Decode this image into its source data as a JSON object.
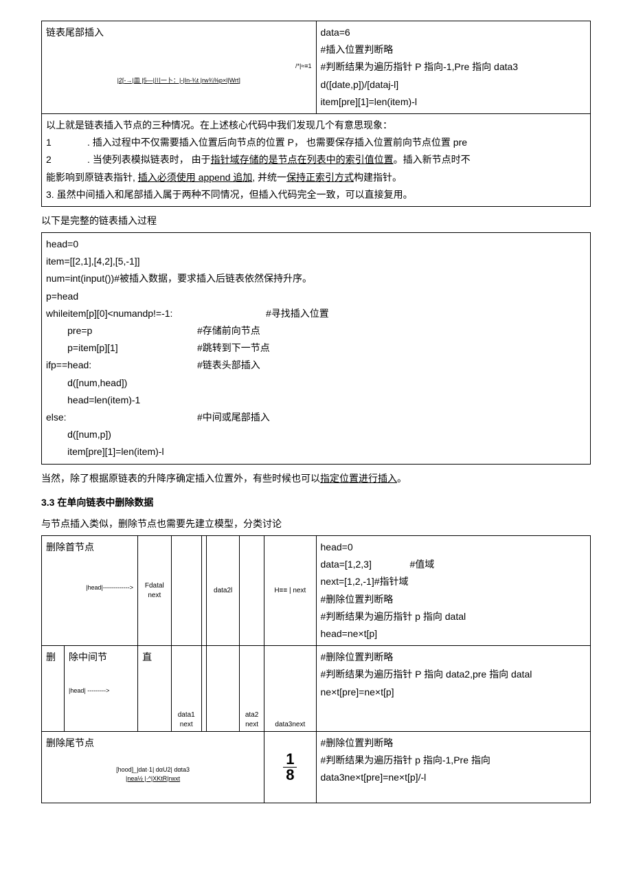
{
  "table1": {
    "left_title": "链表尾部插入",
    "left_diag1": "/*|≈≡1",
    "left_diag2": "|2[-→|皿 |5—|川一卜：|-|In-¾t    |rw¾%p×l|Wrt]",
    "right": {
      "l1": "data=6",
      "l2": "#插入位置判断略",
      "l3": "#判断结果为遍历指针 P 指向-1,Pre 指向 data3",
      "l4": "d([date,p])/[dataj-l]",
      "l5": "item[pre][1]=len(item)-l"
    },
    "summary": {
      "l1": "以上就是链表插入节点的三种情况。在上述核心代码中我们发现几个有意思现象：",
      "l2a": "1",
      "l2b": ". 插入过程中不仅需要插入位置后向节点的位置 P， 也需要保存插入位置前向节点位置 pre",
      "l3a": "2",
      "l3b_pre": ". 当使列表模拟链表时， 由于",
      "l3b_u": "指针域存储的是节点在列表中的索引值位置",
      "l3b_post": "。插入新节点时不",
      "l4_pre": "能影响到原链表指针, ",
      "l4_u1": "插入必须使用 append 追加",
      "l4_mid": ", 并统一",
      "l4_u2": "保持正索引方式",
      "l4_post": "构建指针。",
      "l5": "3. 虽然中间插入和尾部插入属于两种不同情况，但插入代码完全一致，可以直接复用。"
    }
  },
  "pre_code": "以下是完整的链表插入过程",
  "code": {
    "l1": "head=0",
    "l2": "item=[[2,1],[4,2],[5,-1]]",
    "l3": "num=int(input())#被插入数据，要求插入后链表依然保持升序。",
    "l4": "p=head",
    "l5a": "whileitem[p][0]<numandp!=-1:",
    "l5b": "#寻找插入位置",
    "l6a": "        pre=p",
    "l6b": "#存储前向节点",
    "l7a": "        p=item[p][1]",
    "l7b": "#跳转到下一节点",
    "l8a": "ifp==head:",
    "l8b": "#链表头部插入",
    "l9": "        d([num,head])",
    "l10": "        head=len(item)-1",
    "l11a": "else:",
    "l11b": "#中间或尾部插入",
    "l12": "        d([num,p])",
    "l13": "        item[pre][1]=len(item)-l"
  },
  "post_code_pre": "当然，除了根据原链表的升降序确定插入位置外，有些时候也可以",
  "post_code_u": "指定位置进行插入",
  "post_code_post": "。",
  "section": "3.3   在单向链表中删除数据",
  "section_intro": "与节点插入类似，删除节点也需要先建立模型，分类讨论",
  "table2": {
    "r1": {
      "c1": "删除首节点",
      "c3": "Fdatal\nnext",
      "c6": "data2l",
      "c8": "H≡≡ | next",
      "left_diag": "|head|------------->",
      "rc": {
        "l1": "head=0",
        "l2a": "data=[1,2,3]",
        "l2b": "#值域",
        "l3": "next=[1,2,-1]#指针域",
        "l4": "#删除位置判断略",
        "l5": "#判断结果为遍历指针 p 指向 datal",
        "l6": "head=ne×t[p]"
      }
    },
    "r2": {
      "c1a": "删",
      "c1b": "除中间节",
      "c2": "直",
      "c3": "data1\nnext",
      "c6": "ata2\nnext",
      "c8": "data3next",
      "left_diag": "|head| --------->",
      "rc": {
        "l1": "#删除位置判断略",
        "l2": "#判断结果为遍历指针 P 指向 data2,pre 指向 datal",
        "l3": "ne×t[pre]=ne×t[p]"
      }
    },
    "r3": {
      "c1": "删除尾节点",
      "diag1": "[hood]_|dat·1|               dαU2|         dαta3",
      "diag2": "|nea½ |·^|XKtR|rwxt",
      "frac_top": "1",
      "frac_bot": "8",
      "rc": {
        "l1": "#删除位置判断略",
        "l2": "#判断结果为遍历指针 p 指向-1,Pre 指向",
        "l3": "data3ne×t[pre]=ne×t[p]/-l"
      }
    }
  }
}
